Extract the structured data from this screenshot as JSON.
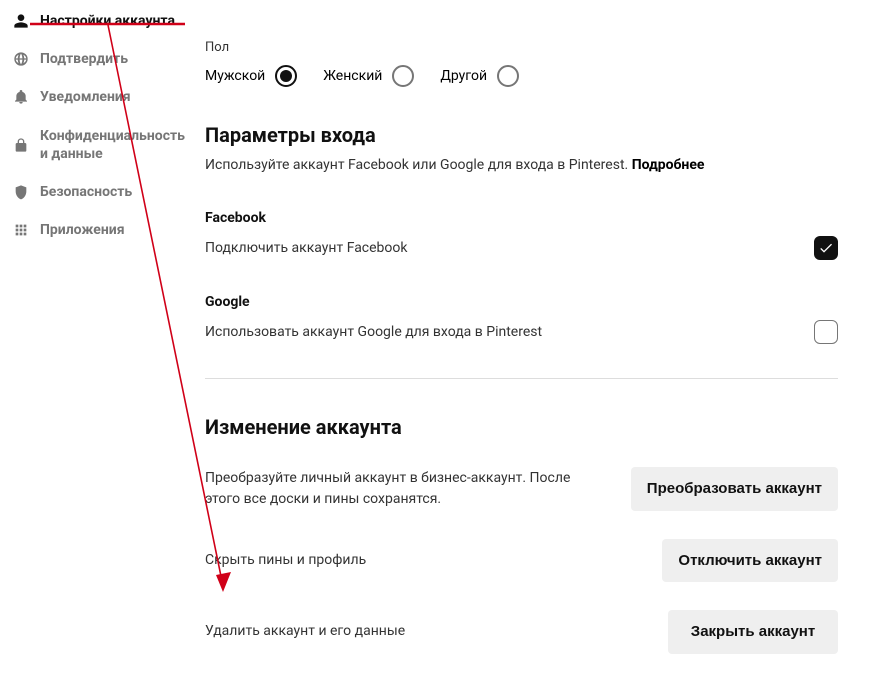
{
  "sidebar": {
    "items": [
      {
        "label": "Настройки аккаунта"
      },
      {
        "label": "Подтвердить"
      },
      {
        "label": "Уведомления"
      },
      {
        "label": "Конфиденциальность и данные"
      },
      {
        "label": "Безопасность"
      },
      {
        "label": "Приложения"
      }
    ]
  },
  "gender": {
    "label": "Пол",
    "options": {
      "male": "Мужской",
      "female": "Женский",
      "other": "Другой"
    }
  },
  "login": {
    "title": "Параметры входа",
    "desc_prefix": "Используйте аккаунт Facebook или Google для входа в Pinterest. ",
    "desc_more": "Подробнее",
    "facebook": {
      "name": "Facebook",
      "desc": "Подключить аккаунт Facebook"
    },
    "google": {
      "name": "Google",
      "desc": "Использовать аккаунт Google для входа в Pinterest"
    }
  },
  "accountChange": {
    "title": "Изменение аккаунта",
    "convert": {
      "text": "Преобразуйте личный аккаунт в бизнес-аккаунт. После этого все доски и пины сохранятся.",
      "button": "Преобразовать аккаунт"
    },
    "hide": {
      "text": "Скрыть пины и профиль",
      "button": "Отключить аккаунт"
    },
    "delete": {
      "text": "Удалить аккаунт и его данные",
      "button": "Закрыть аккаунт"
    }
  }
}
